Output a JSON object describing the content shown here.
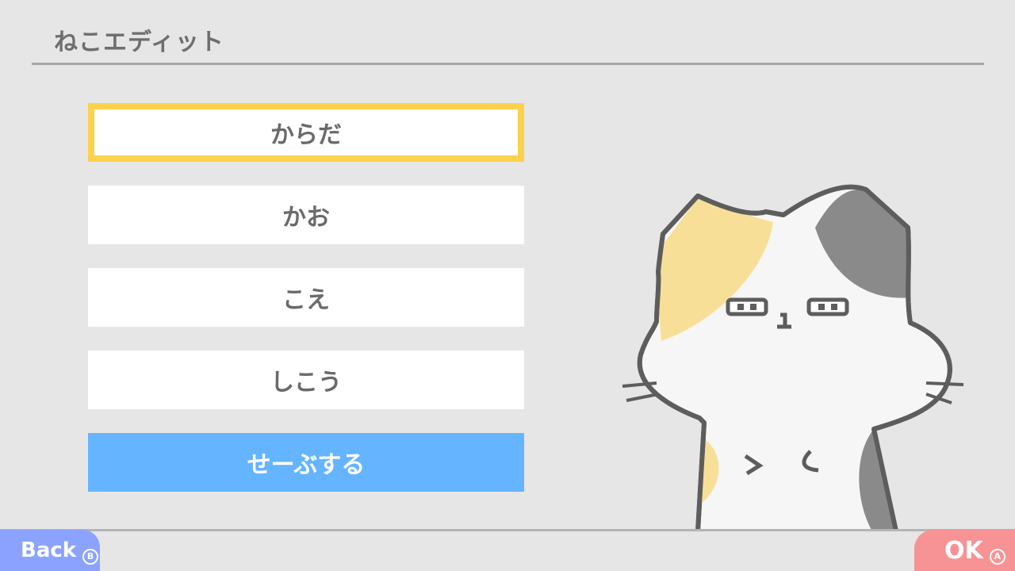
{
  "header": {
    "title": "ねこエディット"
  },
  "menu": {
    "items": [
      {
        "label": "からだ"
      },
      {
        "label": "かお"
      },
      {
        "label": "こえ"
      },
      {
        "label": "しこう"
      }
    ],
    "save_label": "せーぶする"
  },
  "footer": {
    "back_label": "Back",
    "back_key": "B",
    "ok_label": "OK",
    "ok_key": "A"
  },
  "colors": {
    "selected_border": "#fbd24c",
    "save_button": "#65b4ff",
    "back_button": "#8ba3ff",
    "ok_button": "#f79394"
  },
  "preview": {
    "character": "calico-cat"
  }
}
